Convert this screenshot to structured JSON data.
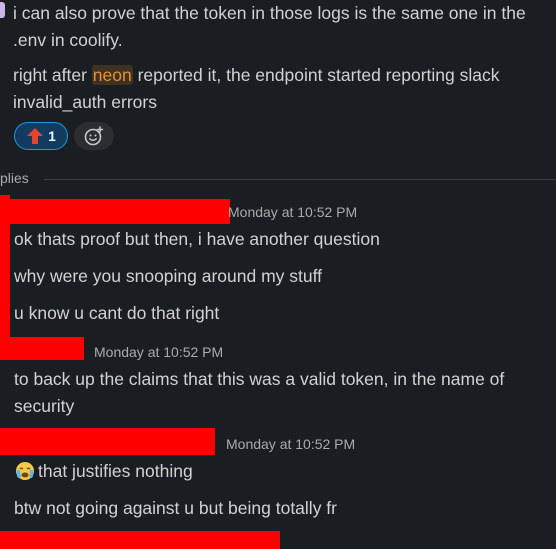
{
  "thread_message": {
    "line1": "i can also prove that the token in those logs is the same one in the",
    "line2": ".env in coolify.",
    "line3_before": "right after ",
    "mention": "neon",
    "line3_after": " reported it, the endpoint started reporting slack",
    "line4": "invalid_auth errors",
    "reaction_count": "1",
    "reaction_icon": "red-up-arrow-icon",
    "add_reaction_icon": "add-emoji-icon"
  },
  "replies_label": "plies",
  "replies": [
    {
      "time": "Monday at 10:52 PM",
      "lines": [
        "ok thats proof but then, i have another question",
        "why were you snooping around my stuff",
        "u know u cant do that right"
      ]
    },
    {
      "time": "Monday at 10:52 PM",
      "lines": [
        "to back up the claims that this was a valid token, in the name of",
        "security"
      ]
    },
    {
      "time": "Monday at 10:52 PM",
      "emoji": "crying-face-emoji",
      "lines": [
        "that justifies nothing",
        "btw not going against u but being totally fr"
      ]
    }
  ],
  "colors": {
    "background": "#1a1d21",
    "text": "#d1d2d3",
    "mention": "#e8912d",
    "redaction": "#ff0000",
    "reaction_bg": "#123b61",
    "reaction_border": "#1d9bd1"
  }
}
